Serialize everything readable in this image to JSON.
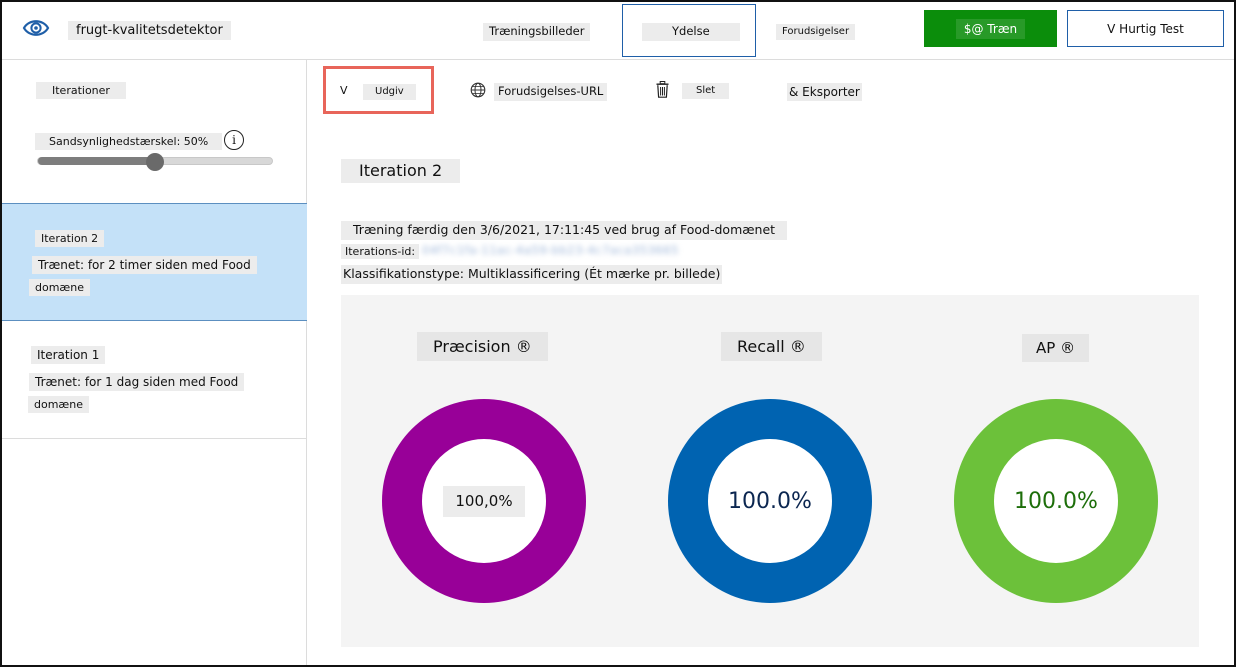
{
  "app": {
    "name": "frugt-kvalitetsdetektor"
  },
  "nav": {
    "tabs": [
      {
        "label": "Træningsbilleder"
      },
      {
        "label": "Ydelse",
        "selected": true
      },
      {
        "label": "Forudsigelser"
      }
    ],
    "train_button": "$@ Træn",
    "quick_test_button": "V Hurtig Test"
  },
  "sidebar": {
    "heading": "Iterationer",
    "threshold_label": "Sandsynlighedstærskel: 50%",
    "threshold_value": 50,
    "info_glyph": "i",
    "iterations": [
      {
        "name": "Iteration 2",
        "desc": "Trænet: for 2 timer siden med Food",
        "desc2": "domæne",
        "selected": true
      },
      {
        "name": "Iteration 1",
        "desc": "Trænet: for 1 dag siden med Food",
        "desc2": "domæne",
        "selected": false
      }
    ]
  },
  "toolbar": {
    "publish_glyph": "V",
    "publish": "Udgiv",
    "prediction_url": "Forudsigelses-URL",
    "delete": "Slet",
    "export": "& Eksporter"
  },
  "main": {
    "title": "Iteration 2",
    "trained_line": "Træning færdig den 3/6/2021, 17:11:45 ved brug af Food-domænet",
    "iteration_id_label": "Iterations-id:",
    "iteration_id_value": "04f7c1fa-11ac-4a59-bb23-4c7aca353665",
    "classification_line": "Klassifikationstype: Multiklassificering (Ét mærke pr. billede)"
  },
  "metrics": [
    {
      "title": "Præcision ®",
      "value": "100,0%",
      "percent": 100,
      "color": "#980098",
      "value_color": "#111111"
    },
    {
      "title": "Recall ®",
      "value": "100.0%",
      "percent": 100,
      "color": "#0063b1",
      "value_color": "#0b2650"
    },
    {
      "title": "AP ®",
      "value": "100.0%",
      "percent": 100,
      "color": "#6cc13a",
      "value_color": "#1d6e0a"
    }
  ],
  "colors": {
    "accent_blue": "#1f5fa8",
    "train_green": "#0b8d0b",
    "selected_bg": "#c4e1f8",
    "highlight_red": "#e8655a"
  }
}
